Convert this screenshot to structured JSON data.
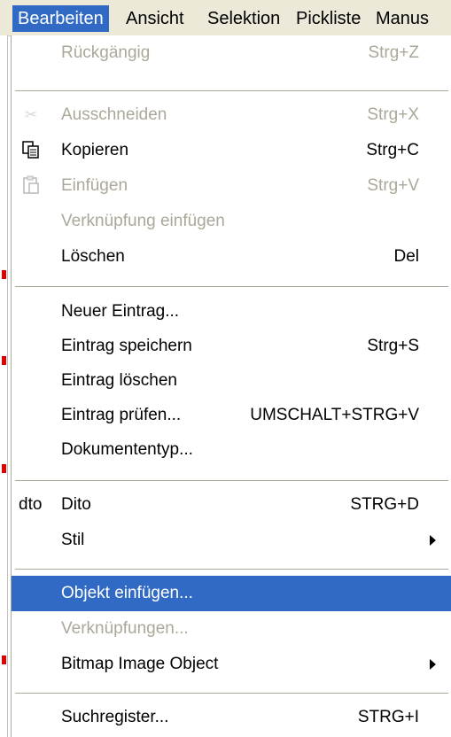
{
  "menubar": {
    "items": [
      {
        "label": "Bearbeiten"
      },
      {
        "label": "Ansicht"
      },
      {
        "label": "Selektion"
      },
      {
        "label": "Pickliste"
      },
      {
        "label": "Manus"
      }
    ]
  },
  "dropdown": {
    "items": [
      {
        "label": "Rückgängig",
        "shortcut": "Strg+Z",
        "enabled": false
      },
      {
        "label": "Ausschneiden",
        "shortcut": "Strg+X",
        "enabled": false,
        "icon": "scissors-icon"
      },
      {
        "label": "Kopieren",
        "shortcut": "Strg+C",
        "enabled": true,
        "icon": "copy-icon"
      },
      {
        "label": "Einfügen",
        "shortcut": "Strg+V",
        "enabled": false,
        "icon": "paste-icon"
      },
      {
        "label": "Verknüpfung einfügen",
        "shortcut": "",
        "enabled": false
      },
      {
        "label": "Löschen",
        "shortcut": "Del",
        "enabled": true
      },
      {
        "label": "Neuer Eintrag...",
        "shortcut": "",
        "enabled": true
      },
      {
        "label": "Eintrag speichern",
        "shortcut": "Strg+S",
        "enabled": true
      },
      {
        "label": "Eintrag löschen",
        "shortcut": "",
        "enabled": true
      },
      {
        "label": "Eintrag prüfen...",
        "shortcut": "UMSCHALT+STRG+V",
        "enabled": true
      },
      {
        "label": "Dokumententyp...",
        "shortcut": "",
        "enabled": true
      },
      {
        "label": "Dito",
        "shortcut": "STRG+D",
        "enabled": true,
        "prefix": "dto"
      },
      {
        "label": "Stil",
        "shortcut": "",
        "enabled": true,
        "submenu": true
      },
      {
        "label": "Objekt einfügen...",
        "shortcut": "",
        "enabled": true,
        "highlighted": true
      },
      {
        "label": "Verknüpfungen...",
        "shortcut": "",
        "enabled": false
      },
      {
        "label": "Bitmap Image Object",
        "shortcut": "",
        "enabled": true,
        "submenu": true
      },
      {
        "label": "Suchregister...",
        "shortcut": "STRG+I",
        "enabled": true
      }
    ]
  },
  "colors": {
    "highlight": "#316ac5",
    "menubar_bg": "#ece9d8",
    "disabled_text": "#aca899"
  }
}
